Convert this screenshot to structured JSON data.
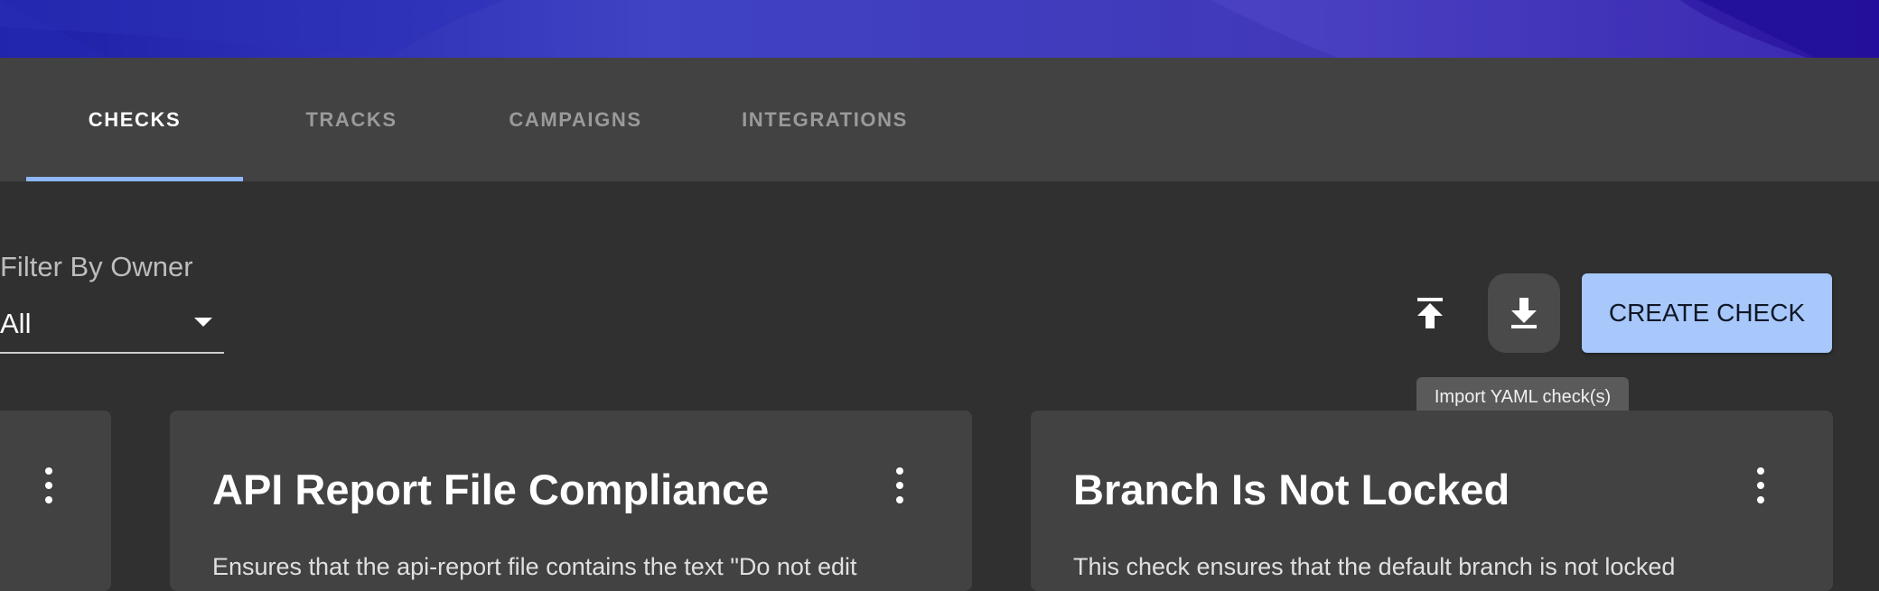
{
  "colors": {
    "accent": "#90b8f8",
    "create_button": "#a8c8fb",
    "background": "#303030",
    "surface": "#424242"
  },
  "tabs": [
    {
      "label": "CHECKS",
      "active": true
    },
    {
      "label": "TRACKS",
      "active": false
    },
    {
      "label": "CAMPAIGNS",
      "active": false
    },
    {
      "label": "INTEGRATIONS",
      "active": false
    }
  ],
  "filter": {
    "label": "Filter By Owner",
    "value": "All"
  },
  "toolbar": {
    "upload_icon": "upload-icon",
    "download_icon": "download-icon",
    "create_label": "CREATE CHECK",
    "tooltip": "Import YAML check(s)"
  },
  "cards": [
    {
      "title": "",
      "description": ""
    },
    {
      "title": "API Report File Compliance",
      "description": "Ensures that the api-report file contains the text \"Do not edit"
    },
    {
      "title": "Branch Is Not Locked",
      "description": "This check ensures that the default branch is not locked"
    }
  ]
}
